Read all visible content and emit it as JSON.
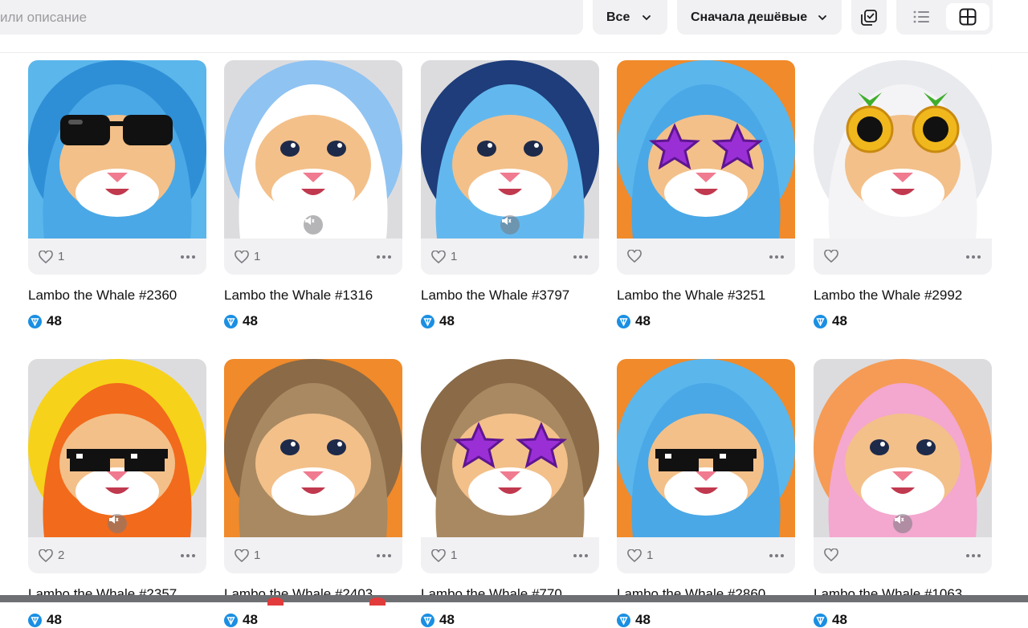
{
  "search": {
    "placeholder": "или описание"
  },
  "filters": {
    "category_label": "Все",
    "sort_label": "Сначала дешёвые"
  },
  "view": {
    "active": "grid"
  },
  "colors": {
    "accent": "#1a8fe3",
    "surface": "#f1f1f3"
  },
  "cards": [
    {
      "title": "Lambo the Whale #2360",
      "likes": "1",
      "price": "48",
      "sound": false,
      "bg": "#5bb6ec",
      "bg2": "#2f8fd6",
      "eyewear": "sunglasses",
      "suit": "#4aa8e6"
    },
    {
      "title": "Lambo the Whale #1316",
      "likes": "1",
      "price": "48",
      "sound": true,
      "bg": "#dcdcdf",
      "bg2": "#8fc3f2",
      "eyewear": "none",
      "suit": "#ffffff"
    },
    {
      "title": "Lambo the Whale #3797",
      "likes": "1",
      "price": "48",
      "sound": true,
      "bg": "#dcdcdf",
      "bg2": "#1e3d7a",
      "eyewear": "none",
      "suit": "#62b8ee"
    },
    {
      "title": "Lambo the Whale #3251",
      "likes": "",
      "price": "48",
      "sound": false,
      "bg": "#f08a2a",
      "bg2": "#5bb6ec",
      "eyewear": "stars",
      "suit": "#4aa8e6"
    },
    {
      "title": "Lambo the Whale #2992",
      "likes": "",
      "price": "48",
      "sound": false,
      "bg": "#ffffff",
      "bg2": "#e9eaee",
      "eyewear": "pineapple",
      "suit": "#f4f4f6"
    },
    {
      "title": "Lambo the Whale #2357",
      "likes": "2",
      "price": "48",
      "sound": true,
      "bg": "#dcdcdf",
      "bg2": "#f7d21a",
      "eyewear": "pixel",
      "suit": "#f26a1b"
    },
    {
      "title": "Lambo the Whale #2403",
      "likes": "1",
      "price": "48",
      "sound": false,
      "bg": "#f08a2a",
      "bg2": "#8a6a47",
      "eyewear": "none",
      "suit": "#a88962"
    },
    {
      "title": "Lambo the Whale #770",
      "likes": "1",
      "price": "48",
      "sound": false,
      "bg": "#ffffff",
      "bg2": "#8a6a47",
      "eyewear": "stars",
      "suit": "#a88962"
    },
    {
      "title": "Lambo the Whale #2860",
      "likes": "1",
      "price": "48",
      "sound": false,
      "bg": "#f08a2a",
      "bg2": "#5bb6ec",
      "eyewear": "pixel",
      "suit": "#4aa8e6"
    },
    {
      "title": "Lambo the Whale #1063",
      "likes": "",
      "price": "48",
      "sound": true,
      "bg": "#dcdcdf",
      "bg2": "#f59b55",
      "eyewear": "none",
      "suit": "#f4a7cf"
    }
  ]
}
